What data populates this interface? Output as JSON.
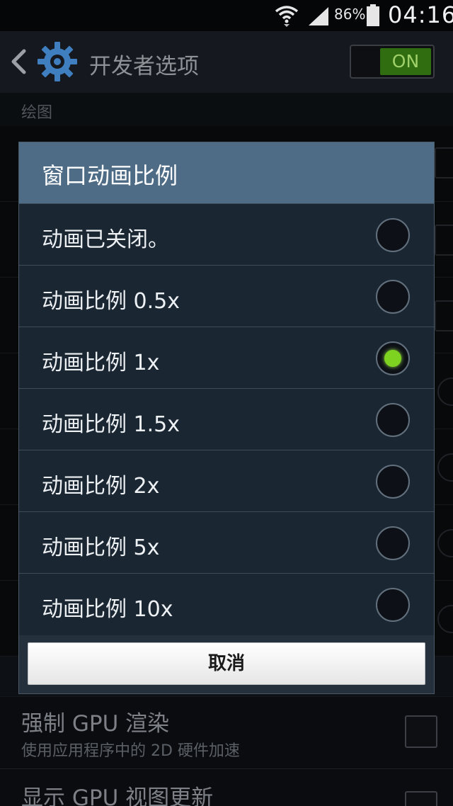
{
  "status_bar": {
    "battery_percent": "86%",
    "time": "04:16"
  },
  "action_bar": {
    "title": "开发者选项",
    "switch_label": "ON"
  },
  "section": {
    "label": "绘图"
  },
  "dialog": {
    "title": "窗口动画比例",
    "options": [
      {
        "label": "动画已关闭。",
        "selected": false
      },
      {
        "label": "动画比例 0.5x",
        "selected": false
      },
      {
        "label": "动画比例 1x",
        "selected": true
      },
      {
        "label": "动画比例 1.5x",
        "selected": false
      },
      {
        "label": "动画比例 2x",
        "selected": false
      },
      {
        "label": "动画比例 5x",
        "selected": false
      },
      {
        "label": "动画比例 10x",
        "selected": false
      }
    ],
    "cancel_label": "取消"
  },
  "rows": {
    "force_gpu": {
      "title": "强制 GPU 渲染",
      "subtitle": "使用应用程序中的 2D 硬件加速"
    },
    "show_gpu": {
      "title": "显示 GPU 视图更新"
    }
  },
  "colors": {
    "accent": "#7ed321",
    "dialog_header": "#4f6c86",
    "switch_on": "#2f6d10"
  }
}
